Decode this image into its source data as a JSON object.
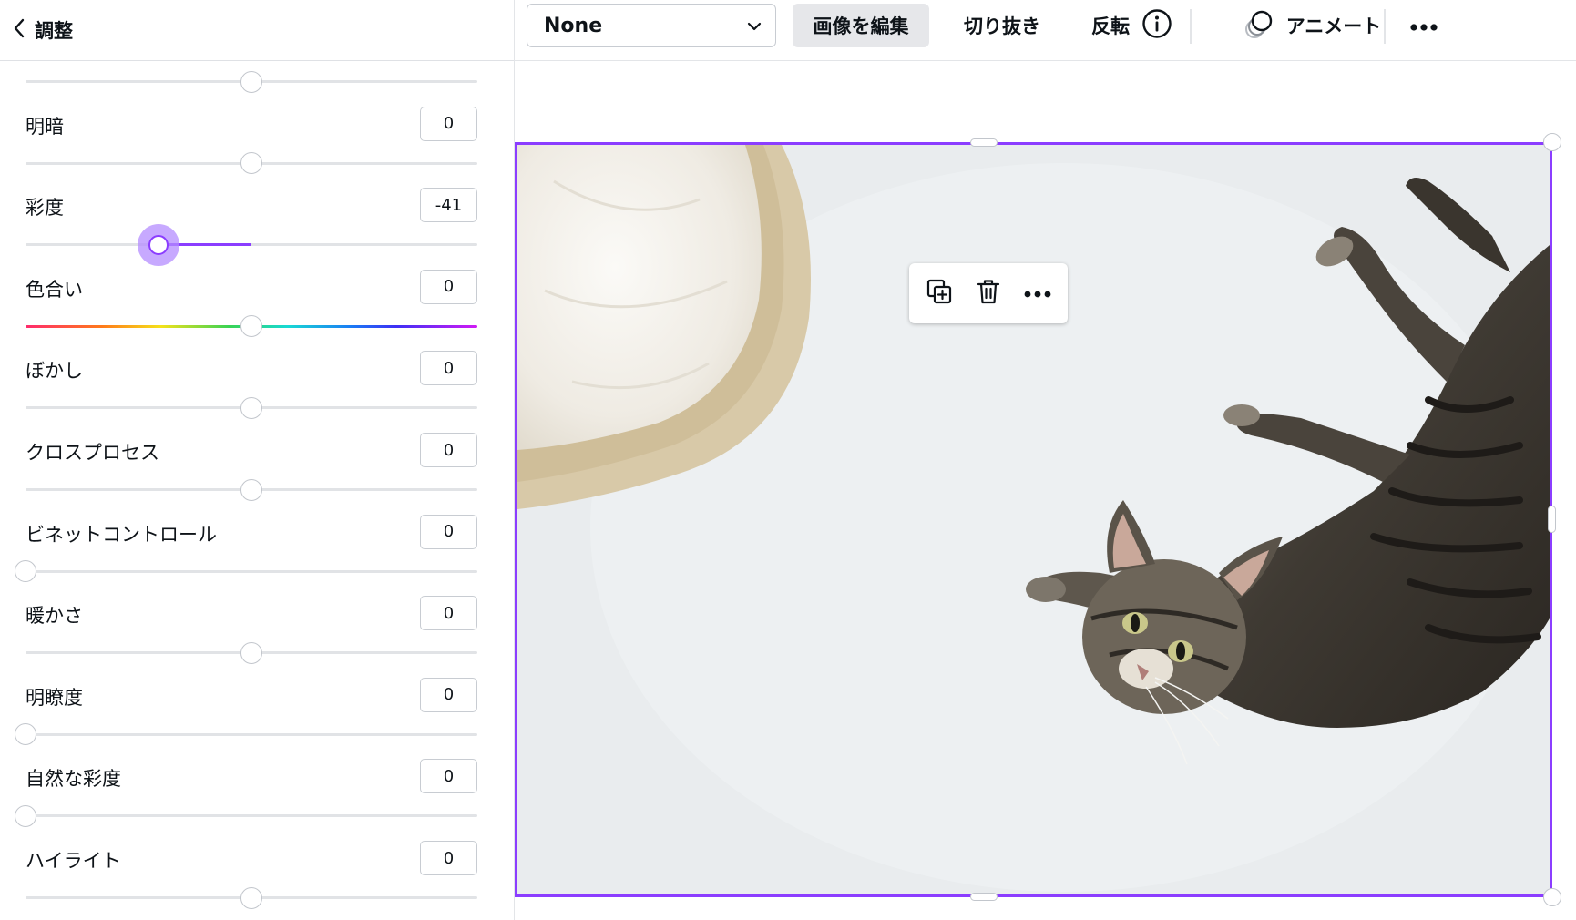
{
  "panel": {
    "title": "調整",
    "back_icon": "chevron-left-icon"
  },
  "sliders": [
    {
      "id": "top-partial",
      "label": "",
      "value": "",
      "position": 0.5,
      "kind": "neutral"
    },
    {
      "id": "brightness",
      "label": "明暗",
      "value": "0",
      "position": 0.5,
      "kind": "neutral"
    },
    {
      "id": "saturation",
      "label": "彩度",
      "value": "-41",
      "position": 0.295,
      "kind": "active"
    },
    {
      "id": "tint",
      "label": "色合い",
      "value": "0",
      "position": 0.5,
      "kind": "hue"
    },
    {
      "id": "blur",
      "label": "ぼかし",
      "value": "0",
      "position": 0.5,
      "kind": "neutral"
    },
    {
      "id": "xprocess",
      "label": "クロスプロセス",
      "value": "0",
      "position": 0.5,
      "kind": "neutral"
    },
    {
      "id": "vignette",
      "label": "ビネットコントロール",
      "value": "0",
      "position": 0.0,
      "kind": "neutral"
    },
    {
      "id": "warmth",
      "label": "暖かさ",
      "value": "0",
      "position": 0.5,
      "kind": "neutral"
    },
    {
      "id": "clarity",
      "label": "明瞭度",
      "value": "0",
      "position": 0.0,
      "kind": "neutral"
    },
    {
      "id": "vibrance",
      "label": "自然な彩度",
      "value": "0",
      "position": 0.0,
      "kind": "neutral"
    },
    {
      "id": "highlights",
      "label": "ハイライト",
      "value": "0",
      "position": 0.5,
      "kind": "neutral"
    }
  ],
  "toolbar": {
    "dropdown_value": "None",
    "edit_image": "画像を編集",
    "crop": "切り抜き",
    "flip": "反転",
    "info_icon": "info-icon",
    "animate": "アニメート",
    "more_icon": "more-icon"
  },
  "colors": {
    "accent": "#8b3dff",
    "active_halo": "#b48cff",
    "track": "#e1e3e6"
  },
  "floating_menu": {
    "icons": [
      "duplicate-icon",
      "trash-icon",
      "more-icon"
    ]
  }
}
